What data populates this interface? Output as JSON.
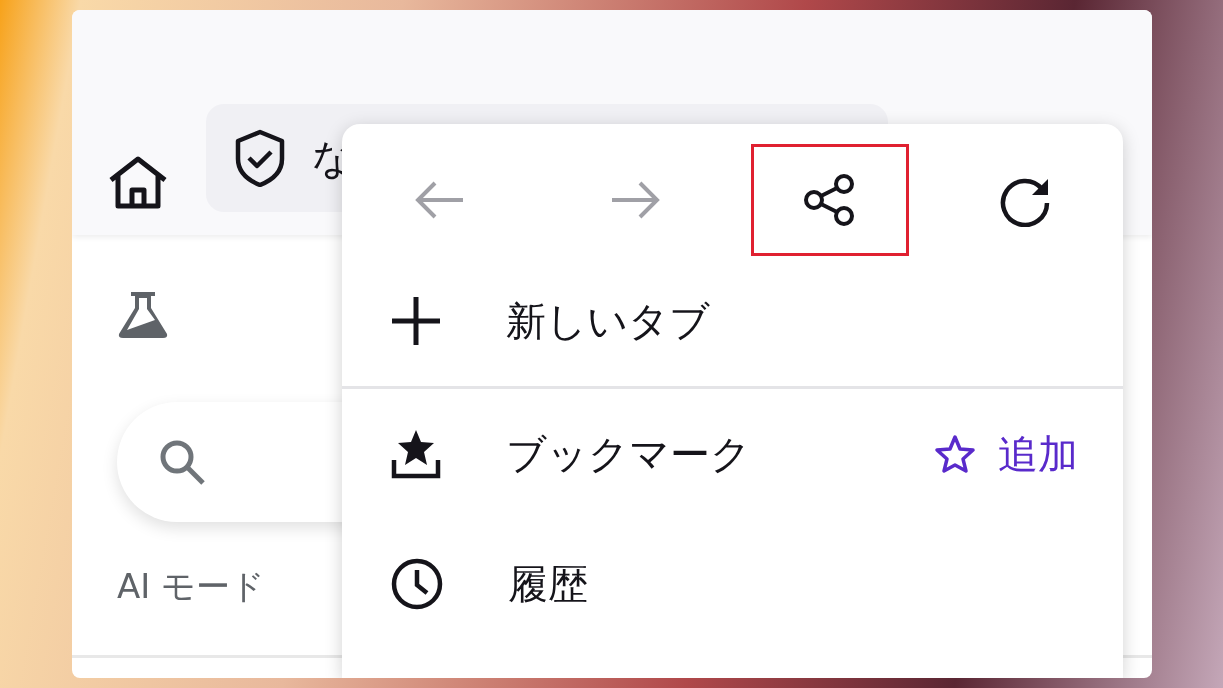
{
  "toolbar": {
    "url_text": "な"
  },
  "page": {
    "ai_mode_label": "AI モード"
  },
  "menu": {
    "nav_actions": [
      {
        "kind": "back",
        "disabled": true,
        "highlighted": false
      },
      {
        "kind": "forward",
        "disabled": true,
        "highlighted": false
      },
      {
        "kind": "share",
        "disabled": false,
        "highlighted": true
      },
      {
        "kind": "reload",
        "disabled": false,
        "highlighted": false
      }
    ],
    "items": [
      {
        "kind": "new-tab",
        "label": "新しいタブ",
        "divider_after": true
      },
      {
        "kind": "bookmark",
        "label": "ブックマーク",
        "action": "追加",
        "divider_after": false
      },
      {
        "kind": "history",
        "label": "履歴",
        "divider_after": false
      }
    ]
  }
}
